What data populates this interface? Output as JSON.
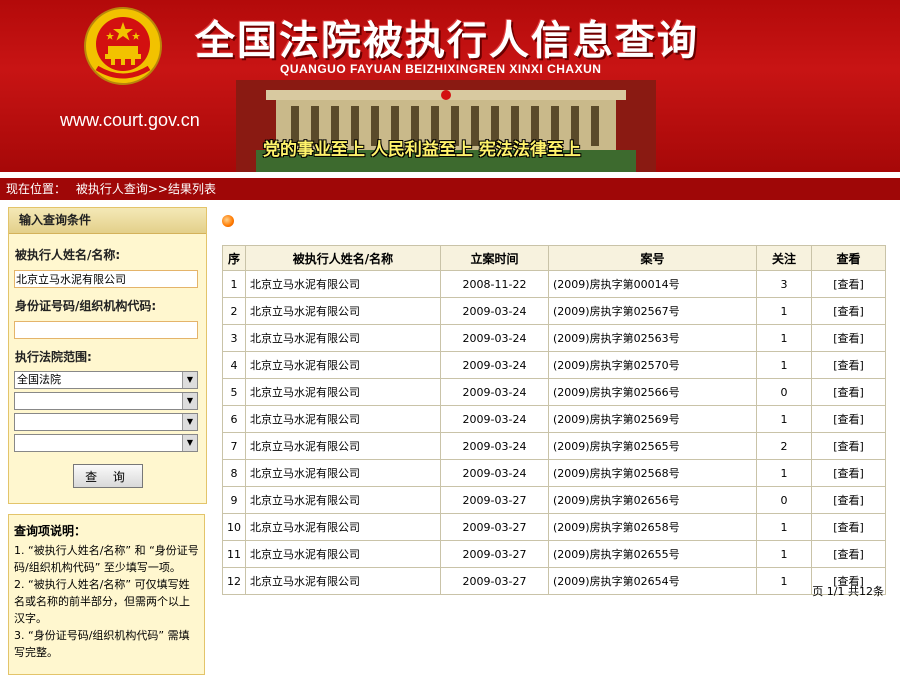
{
  "banner": {
    "site_url": "www.court.gov.cn",
    "title": "全国法院被执行人信息查询",
    "subtitle_pinyin": "QUANGUO FAYUAN BEIZHIXINGREN XINXI CHAXUN",
    "slogan": "党的事业至上 人民利益至上 宪法法律至上"
  },
  "nav": {
    "location_label": "现在位置：",
    "breadcrumb": "被执行人查询>>结果列表"
  },
  "query_form": {
    "header": "输入查询条件",
    "name_label": "被执行人姓名/名称:",
    "name_value": "北京立马水泥有限公司",
    "id_label": "身份证号码/组织机构代码:",
    "id_value": "",
    "court_label": "执行法院范围:",
    "court_select_value": "全国法院",
    "query_button": "查 询"
  },
  "help": {
    "title": "查询项说明：",
    "line1": "1. “被执行人姓名/名称” 和 “身份证号码/组织机构代码” 至少填写一项。",
    "line2": "2. “被执行人姓名/名称” 可仅填写姓名或名称的前半部分，但需两个以上汉字。",
    "line3": "3. “身份证号码/组织机构代码” 需填写完整。"
  },
  "table": {
    "headers": [
      "序",
      "被执行人姓名/名称",
      "立案时间",
      "案号",
      "关注",
      "查看"
    ],
    "rows": [
      {
        "no": "1",
        "name": "北京立马水泥有限公司",
        "date": "2008-11-22",
        "case": "(2009)房执字第00014号",
        "follow": "3",
        "view": "[查看]"
      },
      {
        "no": "2",
        "name": "北京立马水泥有限公司",
        "date": "2009-03-24",
        "case": "(2009)房执字第02567号",
        "follow": "1",
        "view": "[查看]"
      },
      {
        "no": "3",
        "name": "北京立马水泥有限公司",
        "date": "2009-03-24",
        "case": "(2009)房执字第02563号",
        "follow": "1",
        "view": "[查看]"
      },
      {
        "no": "4",
        "name": "北京立马水泥有限公司",
        "date": "2009-03-24",
        "case": "(2009)房执字第02570号",
        "follow": "1",
        "view": "[查看]"
      },
      {
        "no": "5",
        "name": "北京立马水泥有限公司",
        "date": "2009-03-24",
        "case": "(2009)房执字第02566号",
        "follow": "0",
        "view": "[查看]"
      },
      {
        "no": "6",
        "name": "北京立马水泥有限公司",
        "date": "2009-03-24",
        "case": "(2009)房执字第02569号",
        "follow": "1",
        "view": "[查看]"
      },
      {
        "no": "7",
        "name": "北京立马水泥有限公司",
        "date": "2009-03-24",
        "case": "(2009)房执字第02565号",
        "follow": "2",
        "view": "[查看]"
      },
      {
        "no": "8",
        "name": "北京立马水泥有限公司",
        "date": "2009-03-24",
        "case": "(2009)房执字第02568号",
        "follow": "1",
        "view": "[查看]"
      },
      {
        "no": "9",
        "name": "北京立马水泥有限公司",
        "date": "2009-03-27",
        "case": "(2009)房执字第02656号",
        "follow": "0",
        "view": "[查看]"
      },
      {
        "no": "10",
        "name": "北京立马水泥有限公司",
        "date": "2009-03-27",
        "case": "(2009)房执字第02658号",
        "follow": "1",
        "view": "[查看]"
      },
      {
        "no": "11",
        "name": "北京立马水泥有限公司",
        "date": "2009-03-27",
        "case": "(2009)房执字第02655号",
        "follow": "1",
        "view": "[查看]"
      },
      {
        "no": "12",
        "name": "北京立马水泥有限公司",
        "date": "2009-03-27",
        "case": "(2009)房执字第02654号",
        "follow": "1",
        "view": "[查看]"
      }
    ]
  },
  "pager": {
    "text": "页 1/1 共12条"
  },
  "colors": {
    "banner_red": "#c81414",
    "nav_red": "#9f0707",
    "panel_bg": "#fff7cf",
    "slogan_yellow": "#fff36b"
  },
  "icons": {
    "emblem": "national-emblem-icon",
    "dot": "orange-bullet-icon",
    "select_arrow": "chevron-down-icon"
  }
}
